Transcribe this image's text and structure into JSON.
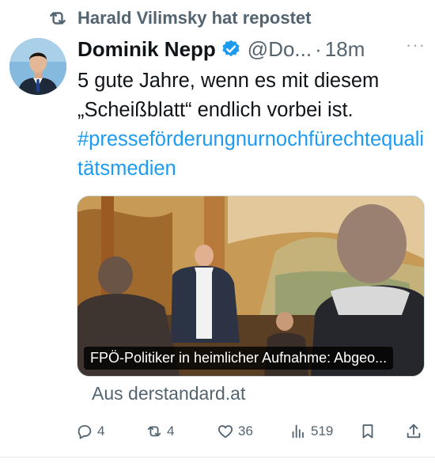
{
  "repost": {
    "text": "Harald Vilimsky hat repostet",
    "icon": "repost-icon"
  },
  "author": {
    "name": "Dominik Nepp",
    "handle": "@Do...",
    "separator": "·",
    "time": "18m",
    "verified": true
  },
  "more_label": "···",
  "body": {
    "line1": "5 gute Jahre, wenn es mit diesem",
    "line2": "„Scheißblatt“ endlich vorbei ist.",
    "hashtag": "#presseförderungnurnochfürechtequalitätsmedien"
  },
  "card": {
    "caption": "FPÖ-Politiker in heimlicher Aufnahme: Abgeo...",
    "source": "Aus derstandard.at"
  },
  "actions": {
    "reply": "4",
    "repost": "4",
    "like": "36",
    "views": "519"
  },
  "colors": {
    "accent": "#1d9bf0",
    "muted": "#536471"
  }
}
